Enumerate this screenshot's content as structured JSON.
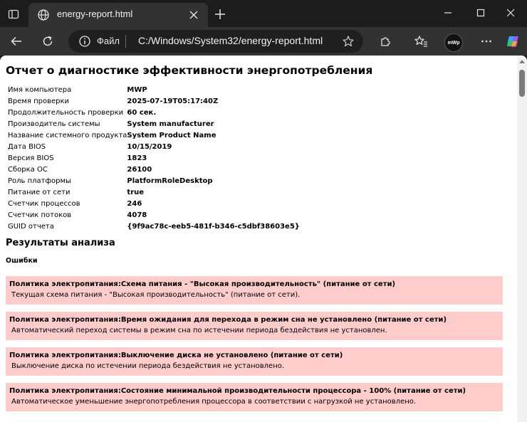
{
  "browser": {
    "tab": {
      "title": "energy-report.html"
    },
    "address_bar": {
      "scheme_label": "Файл",
      "url": "C:/Windows/System32/energy-report.html"
    },
    "profile_label": "mWp"
  },
  "report": {
    "title": "Отчет о диагностике эффективности энергопотребления",
    "info_rows": [
      {
        "label": "Имя компьютера",
        "value": "MWP"
      },
      {
        "label": "Время проверки",
        "value": "2025-07-19T05:17:40Z"
      },
      {
        "label": "Продолжительность проверки",
        "value": "60 сек."
      },
      {
        "label": "Производитель системы",
        "value": "System manufacturer"
      },
      {
        "label": "Название системного продукта",
        "value": "System Product Name"
      },
      {
        "label": "Дата BIOS",
        "value": "10/15/2019"
      },
      {
        "label": "Версия BIOS",
        "value": "1823"
      },
      {
        "label": "Сборка ОС",
        "value": "26100"
      },
      {
        "label": "Роль платформы",
        "value": "PlatformRoleDesktop"
      },
      {
        "label": "Питание от сети",
        "value": "true"
      },
      {
        "label": "Счетчик процессов",
        "value": "246"
      },
      {
        "label": "Счетчик потоков",
        "value": "4078"
      },
      {
        "label": "GUID отчета",
        "value": "{9f9ac78c-eeb5-481f-b346-c5dbf38603e5}"
      }
    ],
    "results_heading": "Результаты анализа",
    "errors_heading": "Ошибки",
    "errors": [
      {
        "title": "Политика электропитания:Схема питания - \"Высокая производительность\" (питание от сети)",
        "description": "Текущая схема питания - \"Высокая производительность\" (питание от сети)."
      },
      {
        "title": "Политика электропитания:Время ожидания для перехода в режим сна не установлено (питание от сети)",
        "description": "Автоматический переход системы в режим сна по истечении периода бездействия не установлен."
      },
      {
        "title": "Политика электропитания:Выключение диска не установлено (питание от сети)",
        "description": "Выключение диска по истечении периода бездействия не установлено."
      },
      {
        "title": "Политика электропитания:Состояние минимальной производительности процессора - 100% (питание от сети)",
        "description": "Автоматическое уменьшение энергопотребления процессора в соответствии с нагрузкой не установлено."
      }
    ]
  },
  "colors": {
    "error_background": "#ffcccc",
    "browser_frame": "#1c1c1c",
    "toolbar": "#323232"
  }
}
